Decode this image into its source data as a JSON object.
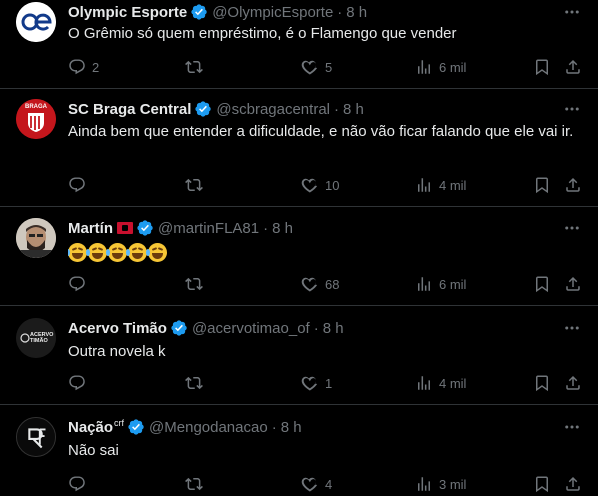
{
  "tweets": [
    {
      "name": "Olympic Esporte",
      "handle": "@OlympicEsporte",
      "time": "8 h",
      "text": "O Grêmio só quem empréstimo, é o Flamengo que vender",
      "replies": "2",
      "retweets": "",
      "likes": "5",
      "views": "6 mil"
    },
    {
      "name": "SC Braga Central",
      "handle": "@scbragacentral",
      "time": "8 h",
      "text": "Ainda bem que entender a dificuldade, e não vão ficar falando que ele vai ir.",
      "replies": "",
      "retweets": "",
      "likes": "10",
      "views": "4 mil",
      "avatar_text": "BRAGA"
    },
    {
      "name": "Martín",
      "handle": "@martinFLA81",
      "time": "8 h",
      "text": "😂😂😂😂😂",
      "replies": "",
      "retweets": "",
      "likes": "68",
      "views": "6 mil"
    },
    {
      "name": "Acervo Timão",
      "handle": "@acervotimao_of",
      "time": "8 h",
      "text": "Outra novela k",
      "replies": "",
      "retweets": "",
      "likes": "1",
      "views": "4 mil",
      "avatar_text": "ACERVO TIMÃO"
    },
    {
      "name": "Nação",
      "name_sup": "crf",
      "handle": "@Mengodanacao",
      "time": "8 h",
      "text": "Não sai",
      "replies": "",
      "retweets": "",
      "likes": "4",
      "views": "3 mil"
    }
  ],
  "separator": "·",
  "colors": {
    "background": "#000000",
    "text": "#e7e9ea",
    "muted": "#71767b",
    "verified": "#1d9bf0",
    "border": "#2f3336"
  },
  "icons": [
    "reply-icon",
    "retweet-icon",
    "like-icon",
    "views-icon",
    "bookmark-icon",
    "share-icon",
    "more-icon",
    "verified-icon"
  ]
}
